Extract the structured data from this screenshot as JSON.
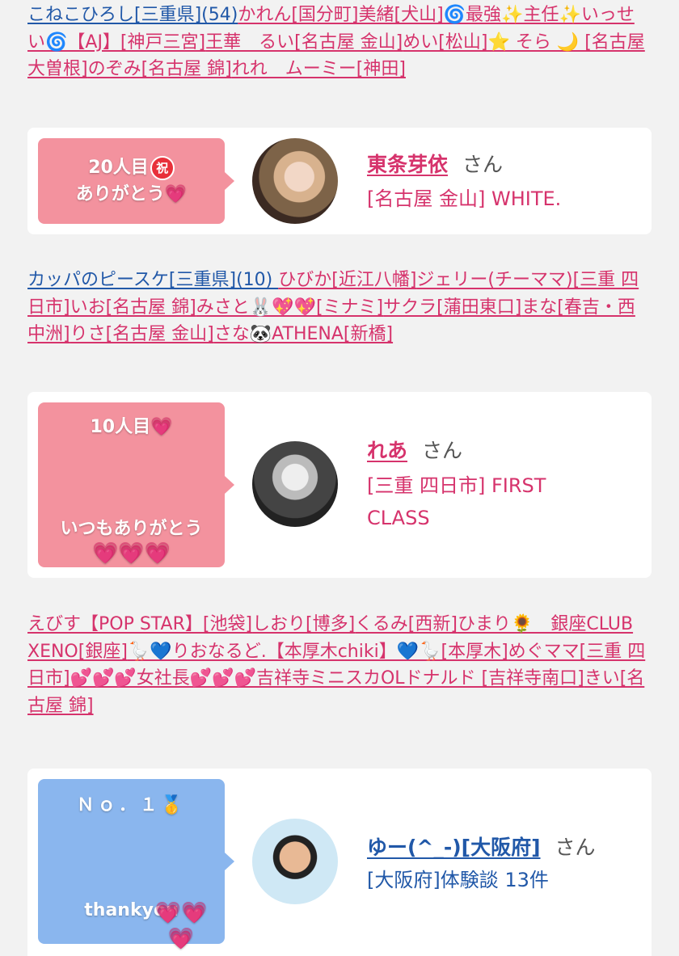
{
  "block1": {
    "links": [
      {
        "text": "こねこひろし[三重県](54)",
        "color": "blue"
      },
      {
        "text": "かれん[国分町]",
        "color": "pink"
      },
      {
        "text": "美緒[犬山]🌀最強✨主任✨いっせい🌀【AJ】[神戸三宮]",
        "color": "pink"
      },
      {
        "text": "王華　るい[名古屋 金山]",
        "color": "pink"
      },
      {
        "text": "めい[松山]⭐ そら 🌙 [名古屋 大曽根]",
        "color": "pink"
      },
      {
        "text": "のぞみ[名古屋 錦]",
        "color": "pink"
      },
      {
        "text": "れれ　ムーミー[神田]",
        "color": "pink"
      }
    ]
  },
  "card1": {
    "bubble_line1": "20人目",
    "bubble_badge": "祝",
    "bubble_line2": "ありがとう",
    "bubble_heart": "💗",
    "name": "東条芽依",
    "san": "さん",
    "shop": "[名古屋 金山] WHITE."
  },
  "block2": {
    "links": [
      {
        "text": "カッパのピースケ[三重県](10) ",
        "color": "blue"
      },
      {
        "text": "ひびか[近江八幡]",
        "color": "pink"
      },
      {
        "text": "ジェリー(チーママ)[三重 四日市]",
        "color": "pink"
      },
      {
        "text": "いお[名古屋 錦]",
        "color": "pink"
      },
      {
        "text": "みさと🐰💖💖[ミナミ]",
        "color": "pink"
      },
      {
        "text": "サクラ[蒲田東口]",
        "color": "pink"
      },
      {
        "text": "まな[春吉・西中洲]",
        "color": "pink"
      },
      {
        "text": "りさ[名古屋 金山]",
        "color": "pink"
      },
      {
        "text": "さな🐼ATHENA[新橋]",
        "color": "pink"
      }
    ]
  },
  "card2": {
    "bubble_line1": "10人目",
    "bubble_heart": "💗",
    "bubble_line2": "いつもありがとう",
    "bubble_hearts": "💗💗💗",
    "name": "れあ",
    "san": "さん",
    "shop": "[三重 四日市] FIRST CLASS"
  },
  "block3": {
    "links": [
      {
        "text": "えびす【POP STAR】[池袋]",
        "color": "pink"
      },
      {
        "text": "しおり[博多]",
        "color": "pink"
      },
      {
        "text": "くるみ[西新]",
        "color": "pink"
      },
      {
        "text": "ひまり🌻　銀座CLUB XENO[銀座]",
        "color": "pink"
      },
      {
        "text": "🪿💙りおなるど.【本厚木chiki】💙🪿[本厚木]",
        "color": "pink"
      },
      {
        "text": "めぐママ[三重 四日市]",
        "color": "pink"
      },
      {
        "text": "💕💕💕女社長💕💕💕吉祥寺ミニスカOLドナルド [吉祥寺南口]",
        "color": "pink"
      },
      {
        "text": "きい[名古屋 錦]",
        "color": "pink"
      }
    ]
  },
  "card3": {
    "bubble_line1": "Ｎｏ．１",
    "bubble_medal": "🥇",
    "bubble_line2": "thankyou",
    "bubble_hearts": "💗💗💗",
    "name": "ゆー(^_-)[大阪府]",
    "san": "さん",
    "shop": "[大阪府]体験談 13件"
  },
  "colors": {
    "pink_link": "#d6336c",
    "blue_link": "#2158a8",
    "bubble_pink": "#f3929e",
    "bubble_blue": "#8ab6ee",
    "background": "#f2f2f2"
  }
}
